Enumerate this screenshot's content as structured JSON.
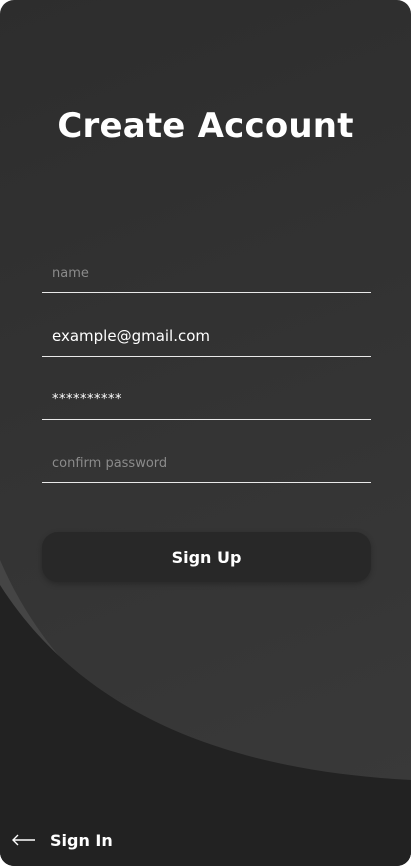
{
  "header": {
    "title": "Create Account"
  },
  "form": {
    "name": {
      "placeholder": "name",
      "value": ""
    },
    "email": {
      "placeholder": "",
      "value": "example@gmail.com"
    },
    "password": {
      "placeholder": "",
      "value": "**********"
    },
    "confirm_password": {
      "placeholder": "confirm password",
      "value": ""
    }
  },
  "actions": {
    "signup_label": "Sign Up",
    "signin_label": "Sign In",
    "signin_icon": "arrow-left-icon"
  },
  "colors": {
    "background": "#333333",
    "curve_dark": "#222222",
    "curve_light": "#454545",
    "button": "#282828",
    "text": "#ffffff",
    "placeholder": "#8b8b8b",
    "underline": "#e9e9e9"
  }
}
